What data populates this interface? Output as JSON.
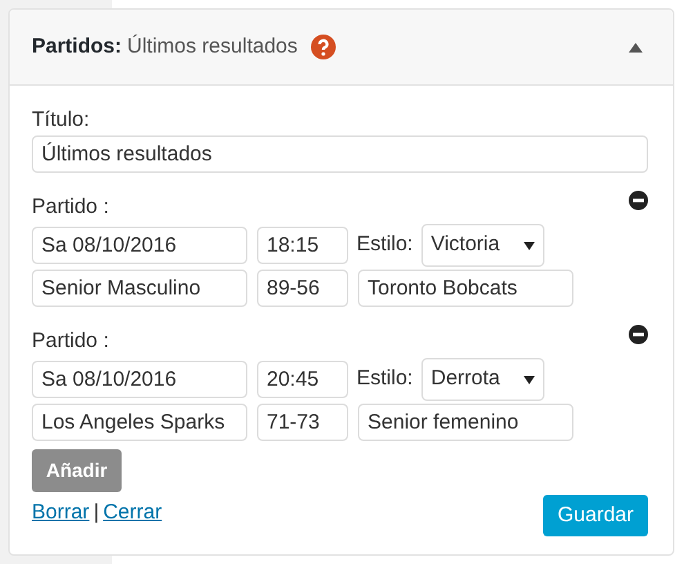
{
  "panel": {
    "title": "Partidos:",
    "subtitle": "Últimos resultados",
    "expanded": true
  },
  "title_field": {
    "label": "Título:",
    "value": "Últimos resultados"
  },
  "matches": [
    {
      "label": "Partido :",
      "date": "Sa 08/10/2016",
      "time": "18:15",
      "style_label": "Estilo:",
      "style": "Victoria",
      "team": "Senior Masculino",
      "score": "89-56",
      "opponent": "Toronto Bobcats"
    },
    {
      "label": "Partido :",
      "date": "Sa 08/10/2016",
      "time": "20:45",
      "style_label": "Estilo:",
      "style": "Derrota",
      "team": "Los Angeles Sparks",
      "score": "71-73",
      "opponent": "Senior femenino"
    }
  ],
  "add_button": {
    "label": "Añadir",
    "disabled": true
  },
  "links": [
    "Borrar",
    "Cerrar"
  ],
  "link_separator": "|",
  "save_button": {
    "label": "Guardar"
  }
}
